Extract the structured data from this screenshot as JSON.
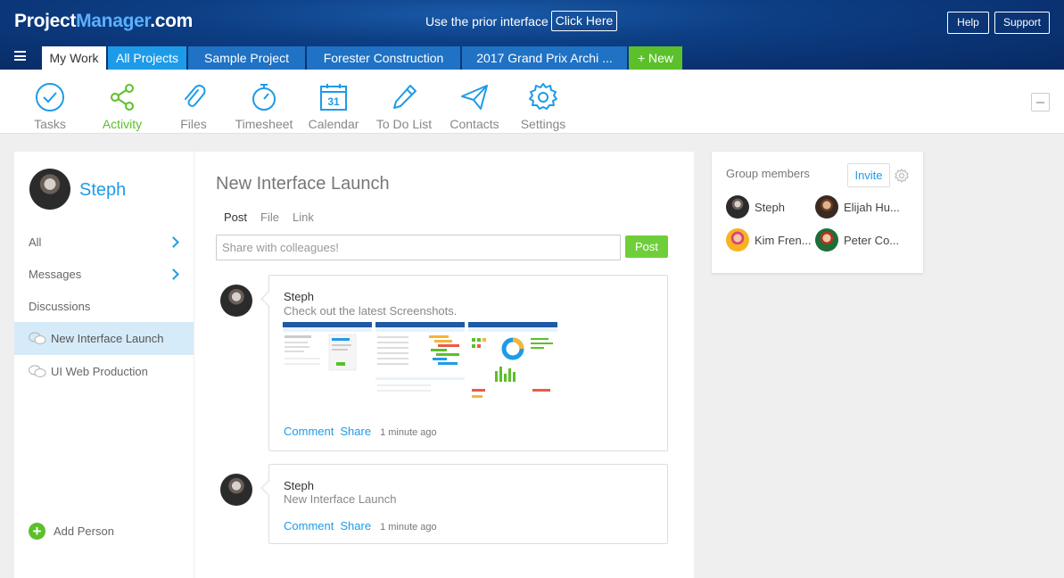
{
  "header": {
    "logo_prefix": "Project",
    "logo_brand": "Manager",
    "logo_suffix": ".com",
    "prior_text": "Use the prior interface",
    "click_here": "Click Here",
    "help": "Help",
    "support": "Support"
  },
  "tabs": {
    "my_work": "My Work",
    "all_projects": "All Projects",
    "sample": "Sample Project",
    "forester": "Forester Construction",
    "grand_prix": "2017 Grand Prix Archi ...",
    "new": "+ New"
  },
  "toolbar": {
    "tasks": "Tasks",
    "activity": "Activity",
    "files": "Files",
    "timesheet": "Timesheet",
    "calendar": "Calendar",
    "calendar_day": "31",
    "todo": "To Do List",
    "contacts": "Contacts",
    "settings": "Settings"
  },
  "left": {
    "user_name": "Steph",
    "all": "All",
    "messages": "Messages",
    "discussions": "Discussions",
    "discussion_items": [
      "New Interface Launch",
      "UI Web Production"
    ],
    "add_person": "Add Person"
  },
  "main": {
    "title": "New Interface Launch",
    "post_tabs": [
      "Post",
      "File",
      "Link"
    ],
    "share_placeholder": "Share with colleagues!",
    "post_button": "Post",
    "posts": [
      {
        "author": "Steph",
        "text": "Check out the latest Screenshots.",
        "comment": "Comment",
        "share": "Share",
        "time": "1 minute ago"
      },
      {
        "author": "Steph",
        "text": "New Interface Launch",
        "comment": "Comment",
        "share": "Share",
        "time": "1 minute ago"
      }
    ]
  },
  "group": {
    "title": "Group members",
    "invite": "Invite",
    "members": [
      "Steph",
      "Elijah Hu...",
      "Kim Fren...",
      "Peter Co..."
    ]
  },
  "colors": {
    "accent_blue": "#1e9be8",
    "accent_green": "#5bc02a",
    "header_navy": "#0a3272"
  }
}
